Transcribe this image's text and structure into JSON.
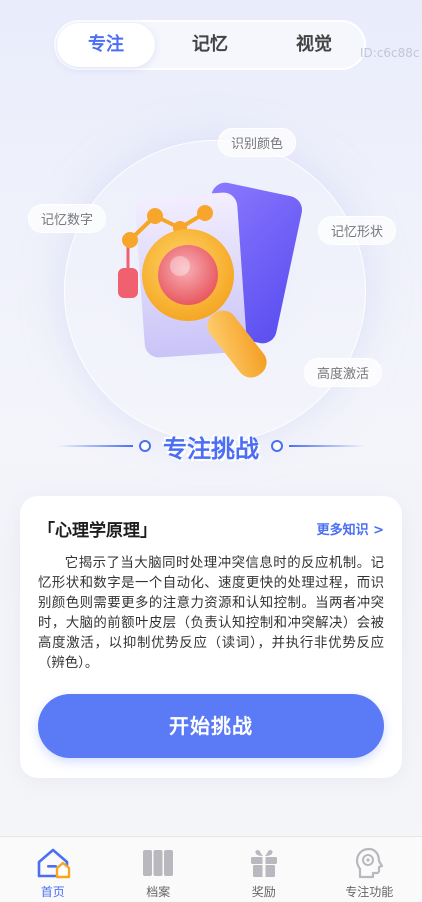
{
  "tabs": [
    {
      "label": "专注",
      "active": true
    },
    {
      "label": "记忆",
      "active": false
    },
    {
      "label": "视觉",
      "active": false
    }
  ],
  "id_label": "ID:c6c88c",
  "hero": {
    "chips": {
      "top": "识别颜色",
      "left": "记忆数字",
      "right": "记忆形状",
      "bottom_right": "高度激活"
    }
  },
  "section_title": "专注挑战",
  "card": {
    "title": "「心理学原理」",
    "more_link": "更多知识 >",
    "body": "它揭示了当大脑同时处理冲突信息时的反应机制。记忆形状和数字是一个自动化、速度更快的处理过程，而识别颜色则需要更多的注意力资源和认知控制。当两者冲突时，大脑的前额叶皮层（负责认知控制和冲突解决）会被高度激活，以抑制优势反应（读词），并执行非优势反应（辨色）。",
    "button": "开始挑战"
  },
  "nav": [
    {
      "label": "首页",
      "icon": "home-icon",
      "active": true
    },
    {
      "label": "档案",
      "icon": "archive-icon",
      "active": false
    },
    {
      "label": "奖励",
      "icon": "gift-icon",
      "active": false
    },
    {
      "label": "专注功能",
      "icon": "brain-head-icon",
      "active": false
    }
  ],
  "colors": {
    "accent": "#4b6ef5",
    "button": "#5b7bf6",
    "nav_inactive": "#b8b8be"
  }
}
